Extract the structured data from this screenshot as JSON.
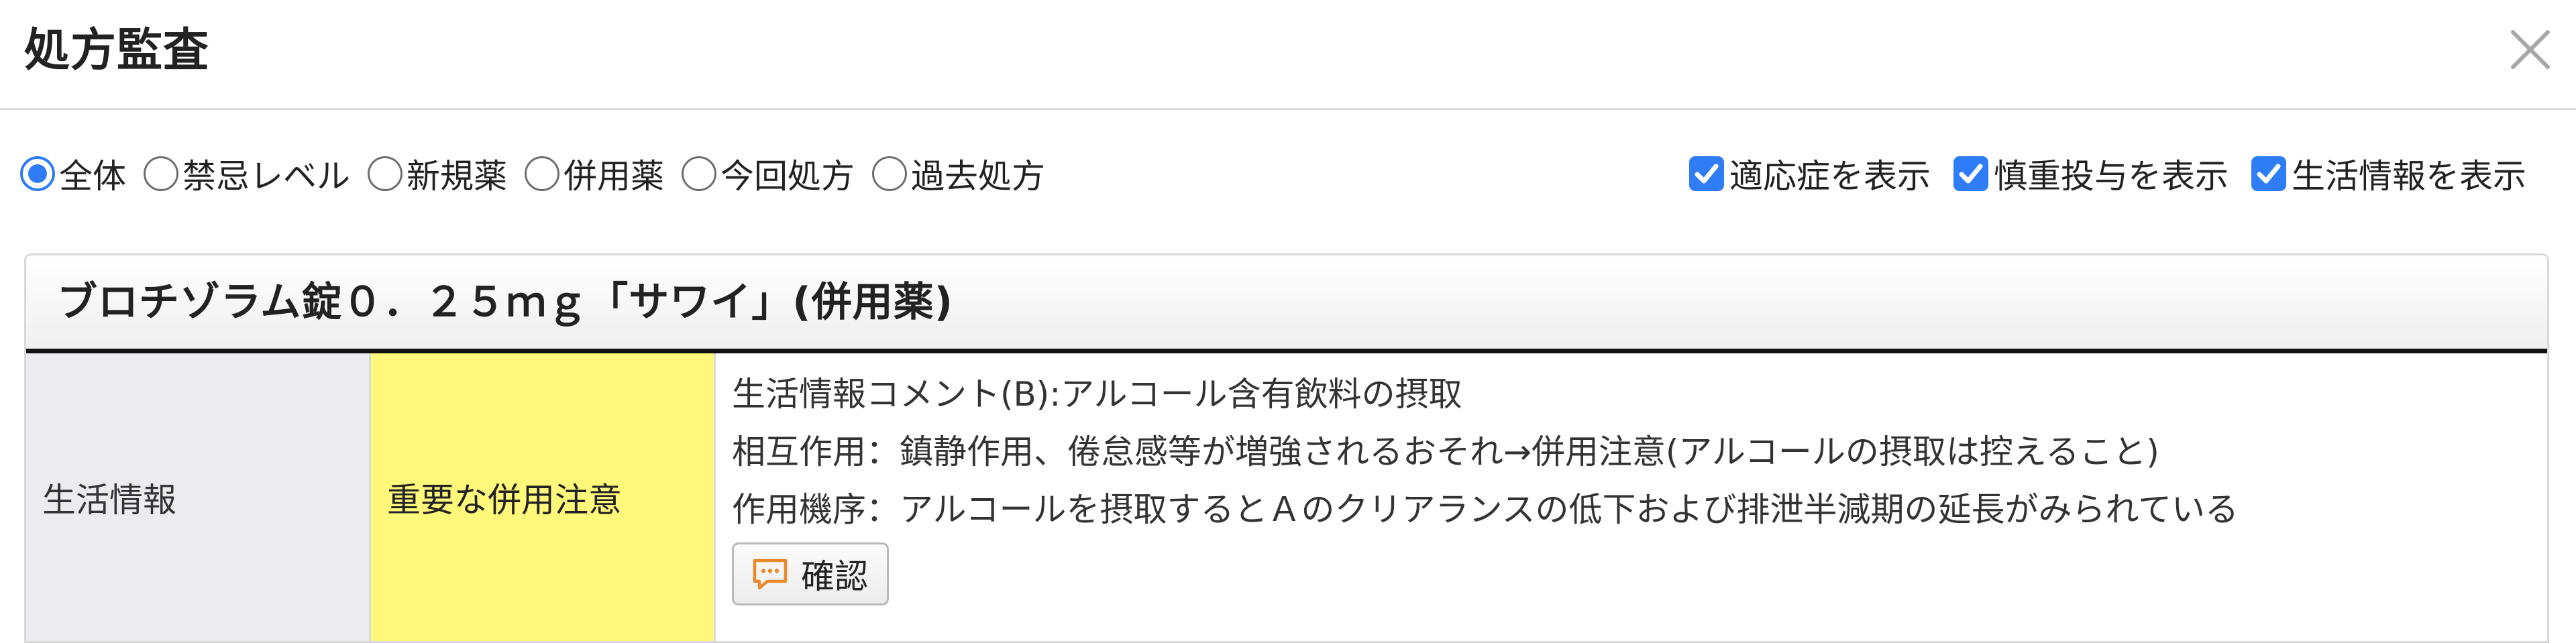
{
  "dialog": {
    "title": "処方監査"
  },
  "filters": {
    "radios": [
      {
        "label": "全体",
        "checked": true
      },
      {
        "label": "禁忌レベル",
        "checked": false
      },
      {
        "label": "新規薬",
        "checked": false
      },
      {
        "label": "併用薬",
        "checked": false
      },
      {
        "label": "今回処方",
        "checked": false
      },
      {
        "label": "過去処方",
        "checked": false
      }
    ],
    "checkboxes": [
      {
        "label": "適応症を表示",
        "checked": true
      },
      {
        "label": "慎重投与を表示",
        "checked": true
      },
      {
        "label": "生活情報を表示",
        "checked": true
      }
    ]
  },
  "panel": {
    "drug_name": "ブロチゾラム錠０．２５ｍｇ「サワイ」(併用薬)",
    "rows": [
      {
        "category": "生活情報",
        "level": "重要な併用注意",
        "details": [
          "生活情報コメント(B):アルコール含有飲料の摂取",
          "相互作用：鎮静作用、倦怠感等が増強されるおそれ→併用注意(アルコールの摂取は控えること)",
          "作用機序：アルコールを摂取するとＡのクリアランスの低下および排泄半減期の延長がみられている"
        ],
        "confirm_label": "確認"
      }
    ]
  },
  "colors": {
    "accent": "#2f7df6",
    "level_highlight": "#fff87a",
    "category_bg": "#ebebf0",
    "confirm_icon": "#e8892c"
  },
  "icons": {
    "close": "close-icon",
    "confirm": "comment-icon"
  }
}
